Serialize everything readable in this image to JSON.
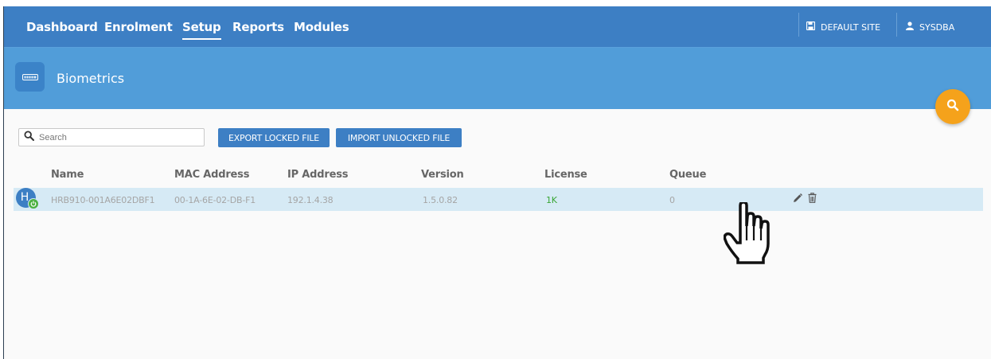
{
  "nav": {
    "items": [
      {
        "label": "Dashboard"
      },
      {
        "label": "Enrolment"
      },
      {
        "label": "Setup"
      },
      {
        "label": "Reports"
      },
      {
        "label": "Modules"
      }
    ],
    "active": "Setup",
    "site_label": "DEFAULT SITE",
    "user_label": "SYSDBA"
  },
  "header": {
    "title": "Biometrics"
  },
  "toolbar": {
    "search_placeholder": "Search",
    "export_label": "EXPORT LOCKED FILE",
    "import_label": "IMPORT UNLOCKED FILE"
  },
  "table": {
    "columns": [
      "Name",
      "MAC Address",
      "IP Address",
      "Version",
      "License",
      "Queue"
    ],
    "rows": [
      {
        "avatar_letter": "H",
        "status": "online",
        "name": "HRB910-001A6E02DBF1",
        "mac": "00-1A-6E-02-DB-F1",
        "ip": "192.1.4.38",
        "version": "1.5.0.82",
        "license": "1K",
        "queue": "0"
      }
    ]
  },
  "icons": {
    "module": "biometric-device-icon",
    "search_fab": "search-icon",
    "site": "save-disk-icon",
    "user": "user-icon",
    "edit": "pencil-icon",
    "delete": "trash-icon",
    "pointer": "hand-pointer-icon"
  },
  "colors": {
    "nav_bg": "#3d7fc4",
    "header_bg": "#519dd9",
    "accent_orange": "#f5a21b",
    "row_highlight": "#d6eaf5",
    "license_green": "#3aa636",
    "status_green": "#4bb141"
  }
}
